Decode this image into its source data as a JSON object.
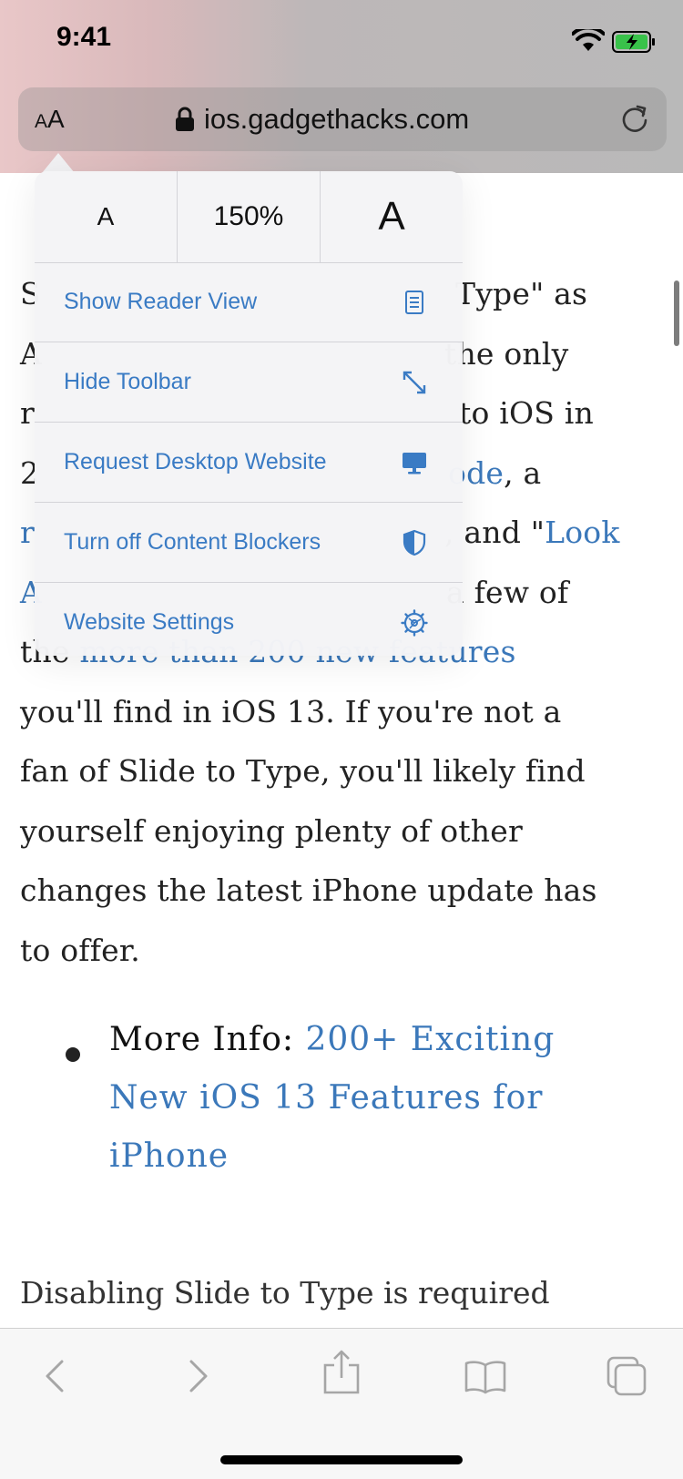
{
  "status": {
    "time": "9:41"
  },
  "address_bar": {
    "aa_small": "A",
    "aa_large": "A",
    "url": "ios.gadgethacks.com"
  },
  "font_controls": {
    "smaller": "A",
    "zoom": "150%",
    "larger": "A"
  },
  "menu": {
    "items": [
      {
        "label": "Show Reader View",
        "icon": "reader-view-icon"
      },
      {
        "label": "Hide Toolbar",
        "icon": "expand-arrows-icon"
      },
      {
        "label": "Request Desktop Website",
        "icon": "desktop-icon"
      },
      {
        "label": "Turn off Content Blockers",
        "icon": "shield-icon"
      },
      {
        "label": "Website Settings",
        "icon": "gear-icon"
      }
    ]
  },
  "article": {
    "lines": [
      {
        "pre": "S",
        "mid": "Type\" as"
      },
      {
        "pre": "A",
        "mid": "the only"
      },
      {
        "pre": "r",
        "mid": "to iOS in"
      },
      {
        "pre": "2",
        "link": "ode",
        "post": ", a"
      },
      {
        "pre": "r",
        "mid": ", and \"",
        "link": "Look"
      },
      {
        "pre": "A",
        "mid": "a few of"
      },
      {
        "pre": "the ",
        "link": "more than 200 new features"
      },
      {
        "text": "you'll find in iOS 13. If you're not a"
      },
      {
        "text": "fan of Slide to Type, you'll likely find"
      },
      {
        "text": "yourself enjoying plenty of other"
      },
      {
        "text": "changes the latest iPhone update has"
      },
      {
        "text": "to offer."
      }
    ],
    "bullet": {
      "label": "More Info: ",
      "link_line1": "200+ Exciting",
      "link_line2": "New iOS 13 Features for",
      "link_line3": "iPhone"
    },
    "cutoff_text": "Disabling Slide to Type is required"
  },
  "colors": {
    "link": "#3b78ba",
    "menu_text": "#3a7bc4",
    "icon_blue": "#3a7bc4"
  }
}
